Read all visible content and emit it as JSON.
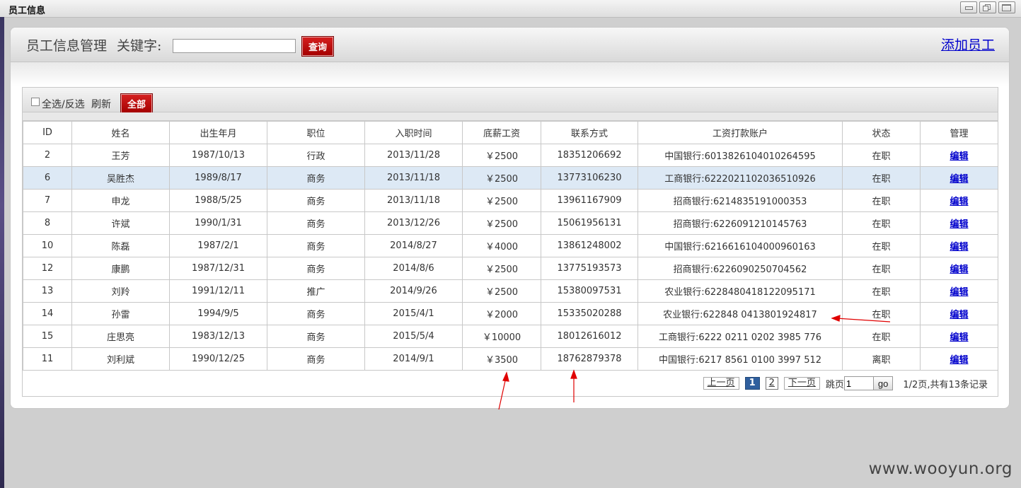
{
  "window": {
    "title": "员工信息"
  },
  "header": {
    "title": "员工信息管理",
    "keyword_label": "关键字:",
    "keyword_value": "",
    "query_label": "查询",
    "add_label": "添加员工"
  },
  "toolbar": {
    "select_all_label": "全选/反选",
    "refresh_label": "刷新",
    "all_label": "全部"
  },
  "table": {
    "columns": [
      "ID",
      "姓名",
      "出生年月",
      "职位",
      "入职时间",
      "底薪工资",
      "联系方式",
      "工资打款账户",
      "状态",
      "管理"
    ],
    "rows": [
      {
        "id": "2",
        "name": "王芳",
        "birth": "1987/10/13",
        "position": "行政",
        "hired": "2013/11/28",
        "salary": "￥2500",
        "phone": "18351206692",
        "account": "中国银行:6013826104010264595",
        "status": "在职",
        "action": "编辑"
      },
      {
        "id": "6",
        "name": "吴胜杰",
        "birth": "1989/8/17",
        "position": "商务",
        "hired": "2013/11/18",
        "salary": "￥2500",
        "phone": "13773106230",
        "account": "工商银行:6222021102036510926",
        "status": "在职",
        "action": "编辑"
      },
      {
        "id": "7",
        "name": "申龙",
        "birth": "1988/5/25",
        "position": "商务",
        "hired": "2013/11/18",
        "salary": "￥2500",
        "phone": "13961167909",
        "account": "招商银行:6214835191000353",
        "status": "在职",
        "action": "编辑"
      },
      {
        "id": "8",
        "name": "许斌",
        "birth": "1990/1/31",
        "position": "商务",
        "hired": "2013/12/26",
        "salary": "￥2500",
        "phone": "15061956131",
        "account": "招商银行:6226091210145763",
        "status": "在职",
        "action": "编辑"
      },
      {
        "id": "10",
        "name": "陈磊",
        "birth": "1987/2/1",
        "position": "商务",
        "hired": "2014/8/27",
        "salary": "￥4000",
        "phone": "13861248002",
        "account": "中国银行:6216616104000960163",
        "status": "在职",
        "action": "编辑"
      },
      {
        "id": "12",
        "name": "康鹏",
        "birth": "1987/12/31",
        "position": "商务",
        "hired": "2014/8/6",
        "salary": "￥2500",
        "phone": "13775193573",
        "account": "招商银行:6226090250704562",
        "status": "在职",
        "action": "编辑"
      },
      {
        "id": "13",
        "name": "刘羚",
        "birth": "1991/12/11",
        "position": "推广",
        "hired": "2014/9/26",
        "salary": "￥2500",
        "phone": "15380097531",
        "account": "农业银行:6228480418122095171",
        "status": "在职",
        "action": "编辑"
      },
      {
        "id": "14",
        "name": "孙雷",
        "birth": "1994/9/5",
        "position": "商务",
        "hired": "2015/4/1",
        "salary": "￥2000",
        "phone": "15335020288",
        "account": "农业银行:622848 0413801924817",
        "status": "在职",
        "action": "编辑"
      },
      {
        "id": "15",
        "name": "庄思亮",
        "birth": "1983/12/13",
        "position": "商务",
        "hired": "2015/5/4",
        "salary": "￥10000",
        "phone": "18012616012",
        "account": "工商银行:6222 0211 0202 3985 776",
        "status": "在职",
        "action": "编辑"
      },
      {
        "id": "11",
        "name": "刘利斌",
        "birth": "1990/12/25",
        "position": "商务",
        "hired": "2014/9/1",
        "salary": "￥3500",
        "phone": "18762879378",
        "account": "中国银行:6217 8561 0100 3997 512",
        "status": "离职",
        "action": "编辑"
      }
    ]
  },
  "pager": {
    "prev_label": "上一页",
    "current_page": "1",
    "page2": "2",
    "next_label": "下一页",
    "jump_label": "跳页",
    "jump_value": "1",
    "go_label": "go",
    "summary": "1/2页,共有13条记录"
  },
  "watermark": "www.wooyun.org",
  "colors": {
    "accent_red": "#c00000",
    "selected_row": "#dde9f5",
    "link": "#0000cc"
  }
}
